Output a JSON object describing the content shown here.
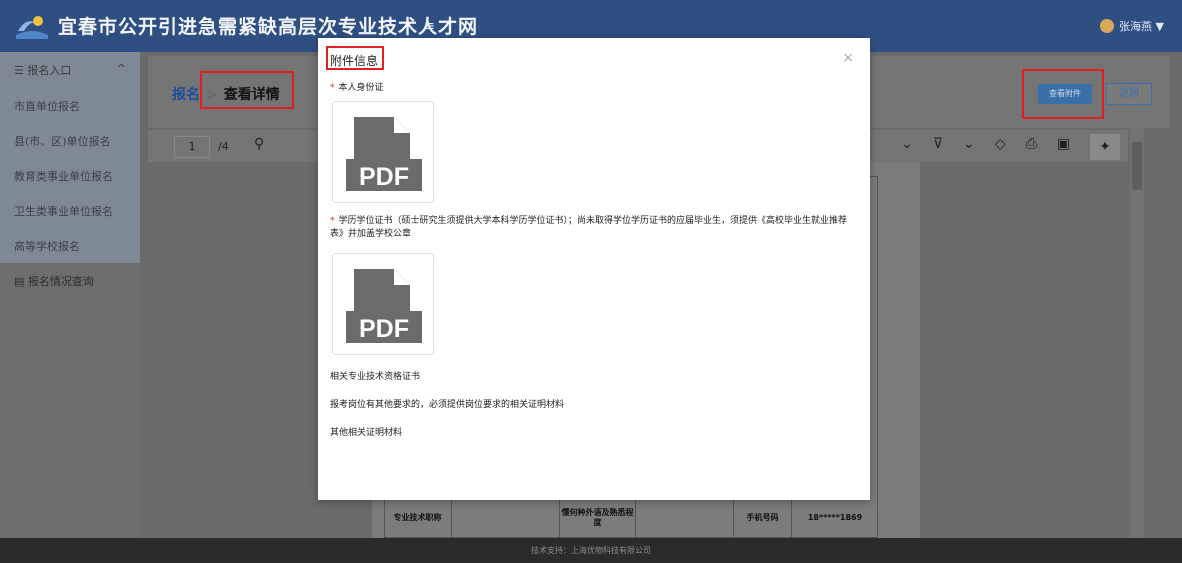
{
  "header": {
    "site_title": "宜春市公开引进急需紧缺高层次专业技术人才网",
    "menu_toggle": "≡",
    "user_name": "张海燕 ▼"
  },
  "sidebar": {
    "group_label": "报名入口",
    "group_caret": "^",
    "items": [
      {
        "label": "市直单位报名"
      },
      {
        "label": "县(市、区)单位报名"
      },
      {
        "label": "教育类事业单位报名"
      },
      {
        "label": "卫生类事业单位报名"
      },
      {
        "label": "高等学校报名"
      }
    ],
    "query_label": "报名情况查询"
  },
  "breadcrumb": {
    "parent": "报名",
    "separator": ">",
    "current": "查看详情"
  },
  "actions": {
    "view_attachments": "查看附件",
    "back": "返回"
  },
  "pdf_viewer": {
    "current_page": "1",
    "total_pages": "/4"
  },
  "document": {
    "row": [
      "专业技术职称",
      "",
      "懂何种外语及熟悉程度",
      "",
      "手机号码",
      "18*****1869"
    ]
  },
  "modal": {
    "title": "附件信息",
    "close": "×",
    "fields": {
      "id_card": "本人身份证",
      "degree": "学历学位证书（硕士研究生须提供大学本科学历学位证书）；尚未取得学位学历证书的应届毕业生，须提供《高校毕业生就业推荐表》并加盖学校公章",
      "qualification": "相关专业技术资格证书",
      "other_required": "报考岗位有其他要求的，必须提供岗位要求的相关证明材料",
      "other": "其他相关证明材料"
    },
    "file_label": "PDF"
  },
  "footer": {
    "text": "技术支持：上海优物科技有限公司"
  }
}
